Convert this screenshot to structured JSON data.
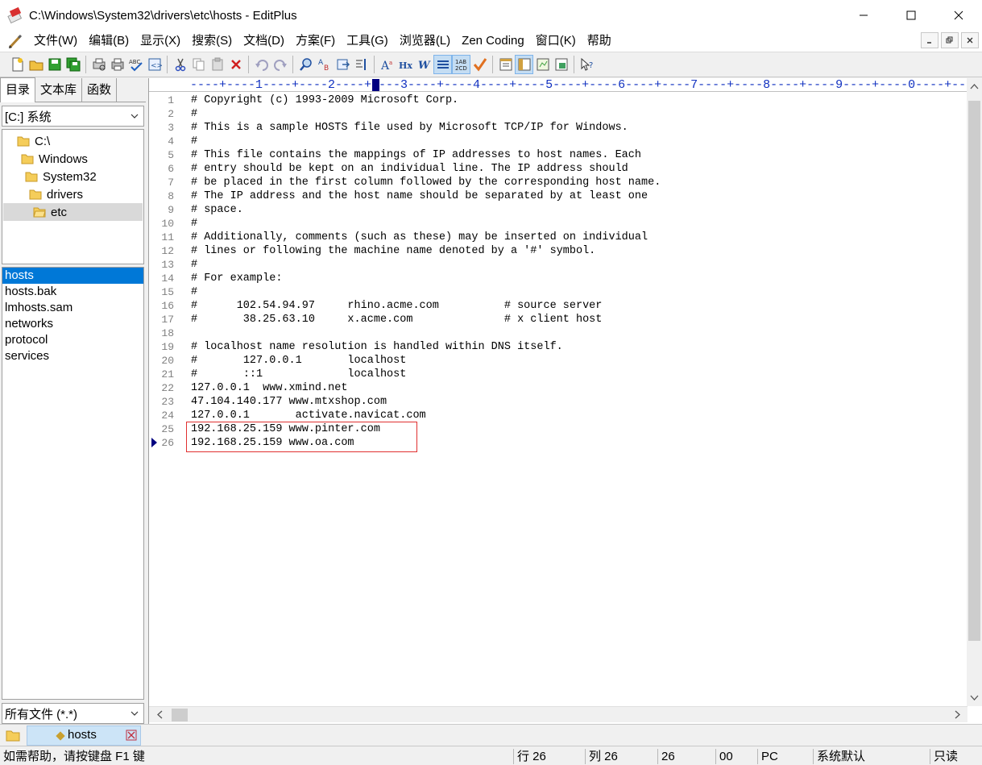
{
  "window": {
    "title": "C:\\Windows\\System32\\drivers\\etc\\hosts - EditPlus"
  },
  "menu": [
    "文件(W)",
    "编辑(B)",
    "显示(X)",
    "搜索(S)",
    "文档(D)",
    "方案(F)",
    "工具(G)",
    "浏览器(L)",
    "Zen Coding",
    "窗口(K)",
    "帮助"
  ],
  "toolbar": {
    "buttons": [
      "new-file",
      "open-file",
      "save",
      "save-all",
      "print-preview",
      "print",
      "spell-check",
      "browser-view",
      "cut",
      "copy",
      "paste",
      "delete",
      "undo",
      "redo",
      "find",
      "replace",
      "goto",
      "indent",
      "font-size",
      "hex",
      "word-wrap",
      "line-numbers",
      "ruler",
      "check",
      "directory-window",
      "cliptext-window",
      "output-window",
      "preview-window",
      "help"
    ]
  },
  "left_panel": {
    "tabs": [
      "目录",
      "文本库",
      "函数"
    ],
    "drive": "[C:] 系统",
    "tree": [
      "C:\\",
      "Windows",
      "System32",
      "drivers",
      "etc"
    ],
    "selected_folder": "etc",
    "files": [
      "hosts",
      "hosts.bak",
      "lmhosts.sam",
      "networks",
      "protocol",
      "services"
    ],
    "selected_file": "hosts",
    "filter": "所有文件 (*.*)"
  },
  "editor": {
    "ruler": "----+----1----+----2----+----3----+----4----+----5----+----6----+----7----+----8----+----9----+----0----+--",
    "lines": [
      "# Copyright (c) 1993-2009 Microsoft Corp.",
      "#",
      "# This is a sample HOSTS file used by Microsoft TCP/IP for Windows.",
      "#",
      "# This file contains the mappings of IP addresses to host names. Each",
      "# entry should be kept on an individual line. The IP address should",
      "# be placed in the first column followed by the corresponding host name.",
      "# The IP address and the host name should be separated by at least one",
      "# space.",
      "#",
      "# Additionally, comments (such as these) may be inserted on individual",
      "# lines or following the machine name denoted by a '#' symbol.",
      "#",
      "# For example:",
      "#",
      "#      102.54.94.97     rhino.acme.com          # source server",
      "#       38.25.63.10     x.acme.com              # x client host",
      "",
      "# localhost name resolution is handled within DNS itself.",
      "#\t127.0.0.1       localhost",
      "#\t::1             localhost",
      "127.0.0.1  www.xmind.net",
      "47.104.140.177 www.mtxshop.com",
      "127.0.0.1       activate.navicat.com",
      "192.168.25.159 www.pinter.com",
      "192.168.25.159 www.oa.com"
    ],
    "current_line": 26
  },
  "doc_tabs": [
    {
      "label": "hosts",
      "active": true
    }
  ],
  "status": {
    "help": "如需帮助，请按键盘 F1 键",
    "row": "行 26",
    "col": "列 26",
    "count": "26",
    "code": "00",
    "format": "PC",
    "encoding": "系统默认",
    "mode": "只读"
  }
}
